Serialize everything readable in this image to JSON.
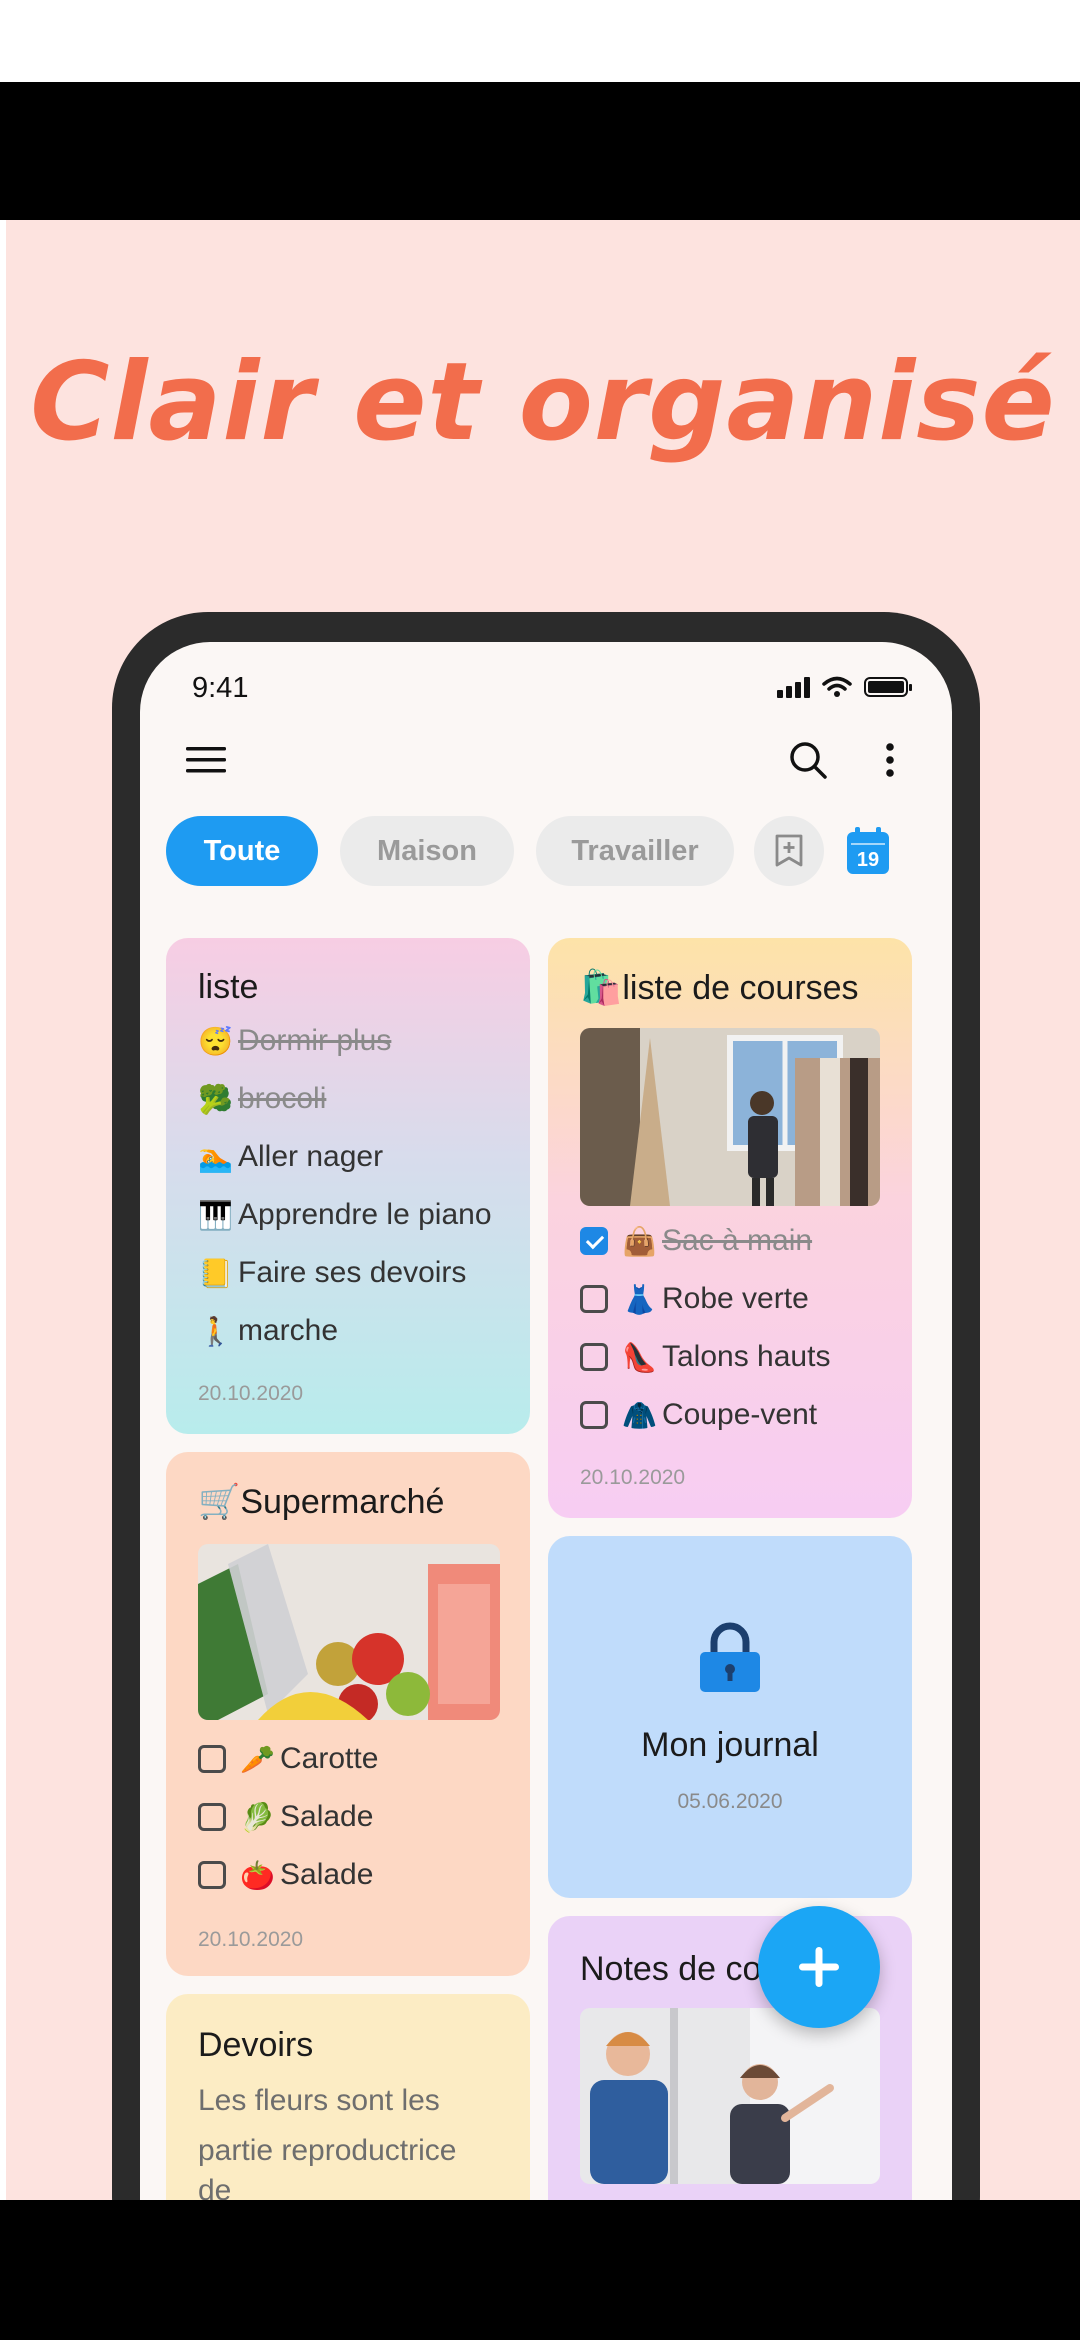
{
  "promo": {
    "headline": "Clair et organisé",
    "background": "#fde3df",
    "headline_color": "#f26d4c"
  },
  "status_bar": {
    "time": "9:41",
    "icons": [
      "signal-icon",
      "wifi-icon",
      "battery-icon"
    ]
  },
  "app_bar": {
    "icons": [
      "menu-icon",
      "search-icon",
      "more-vert-icon"
    ]
  },
  "tabs": [
    {
      "label": "Toute",
      "active": true
    },
    {
      "label": "Maison",
      "active": false
    },
    {
      "label": "Travailler",
      "active": false
    }
  ],
  "tab_actions": {
    "add_category_icon": "add-bookmark-icon",
    "calendar_day": "19"
  },
  "notes": {
    "liste": {
      "title": "liste",
      "items": [
        {
          "emoji": "😴",
          "text": "Dormir plus",
          "done": true
        },
        {
          "emoji": "🥦",
          "text": "brocoli",
          "done": true
        },
        {
          "emoji": "🏊",
          "text": "Aller nager",
          "done": false
        },
        {
          "emoji": "🎹",
          "text": "Apprendre le piano",
          "done": false
        },
        {
          "emoji": "📒",
          "text": "Faire ses devoirs",
          "done": false
        },
        {
          "emoji": "🚶",
          "text": "marche",
          "done": false
        }
      ],
      "date": "20.10.2020"
    },
    "courses": {
      "title": "🛍️liste de courses",
      "items": [
        {
          "emoji": "👜",
          "text": "Sac à main",
          "checked": true
        },
        {
          "emoji": "👗",
          "text": "Robe verte",
          "checked": false
        },
        {
          "emoji": "👠",
          "text": "Talons hauts",
          "checked": false
        },
        {
          "emoji": "🧥",
          "text": "Coupe-vent",
          "checked": false
        }
      ],
      "date": "20.10.2020"
    },
    "supermarche": {
      "title": "🛒Supermarché",
      "items": [
        {
          "emoji": "🥕",
          "text": "Carotte",
          "checked": false
        },
        {
          "emoji": "🥬",
          "text": "Salade",
          "checked": false
        },
        {
          "emoji": "🍅",
          "text": "Salade",
          "checked": false
        }
      ],
      "date": "20.10.2020"
    },
    "journal": {
      "title": "Mon journal",
      "date": "05.06.2020",
      "locked": true
    },
    "devoirs": {
      "title": "Devoirs",
      "body_line1": "Les fleurs sont les",
      "body_line2": "partie reproductrice",
      "body_line3": "de"
    },
    "cours": {
      "title": "Notes de co"
    }
  },
  "fab": {
    "icon": "plus-icon"
  }
}
